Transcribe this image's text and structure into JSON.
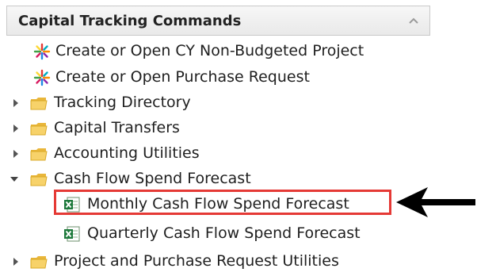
{
  "header": {
    "title": "Capital Tracking Commands",
    "collapse_icon": "chevron-up-icon"
  },
  "colors": {
    "highlight": "#e53935",
    "folder": "#f2c24e",
    "excel": "#1e7a3c"
  },
  "tree": {
    "items": [
      {
        "label": "Create or Open CY Non-Budgeted Project",
        "icon": "spark-icon"
      },
      {
        "label": "Create or Open Purchase Request",
        "icon": "spark-icon"
      },
      {
        "label": "Tracking Directory",
        "icon": "folder-icon",
        "expander": "collapsed"
      },
      {
        "label": "Capital Transfers",
        "icon": "folder-icon",
        "expander": "collapsed"
      },
      {
        "label": "Accounting Utilities",
        "icon": "folder-icon",
        "expander": "collapsed"
      },
      {
        "label": "Cash Flow Spend Forecast",
        "icon": "folder-icon",
        "expander": "expanded"
      },
      {
        "label": "Monthly Cash Flow Spend Forecast",
        "icon": "excel-icon",
        "highlighted": true
      },
      {
        "label": "Quarterly Cash Flow Spend Forecast",
        "icon": "excel-icon"
      },
      {
        "label": "Project and Purchase Request Utilities",
        "icon": "folder-icon",
        "expander": "collapsed"
      }
    ]
  }
}
